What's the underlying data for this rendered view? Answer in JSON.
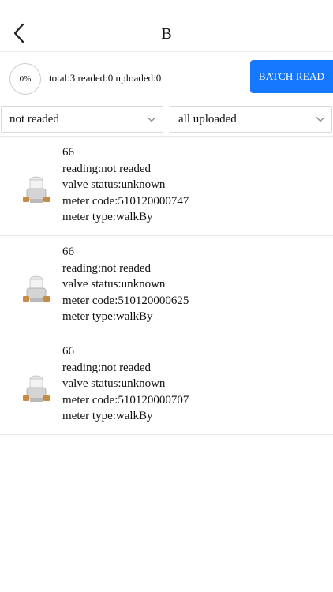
{
  "header": {
    "title": "B",
    "back_icon": "chevron-left-icon"
  },
  "summary": {
    "progress": "0%",
    "stats": "total:3 readed:0 uploaded:0",
    "batch_label": "BATCH READ",
    "batch_color": "#1677ff"
  },
  "filters": {
    "reading_filter": "not readed",
    "upload_filter": "all uploaded",
    "dropdown_icon": "chevron-down-icon"
  },
  "meters": [
    {
      "name": "66",
      "reading": "reading:not readed",
      "valve": "valve status:unknown",
      "code": "meter code:510120000747",
      "type": "meter type:walkBy",
      "icon": "water-meter-icon"
    },
    {
      "name": "66",
      "reading": "reading:not readed",
      "valve": "valve status:unknown",
      "code": "meter code:510120000625",
      "type": "meter type:walkBy",
      "icon": "water-meter-icon"
    },
    {
      "name": "66",
      "reading": "reading:not readed",
      "valve": "valve status:unknown",
      "code": "meter code:510120000707",
      "type": "meter type:walkBy",
      "icon": "water-meter-icon"
    }
  ]
}
